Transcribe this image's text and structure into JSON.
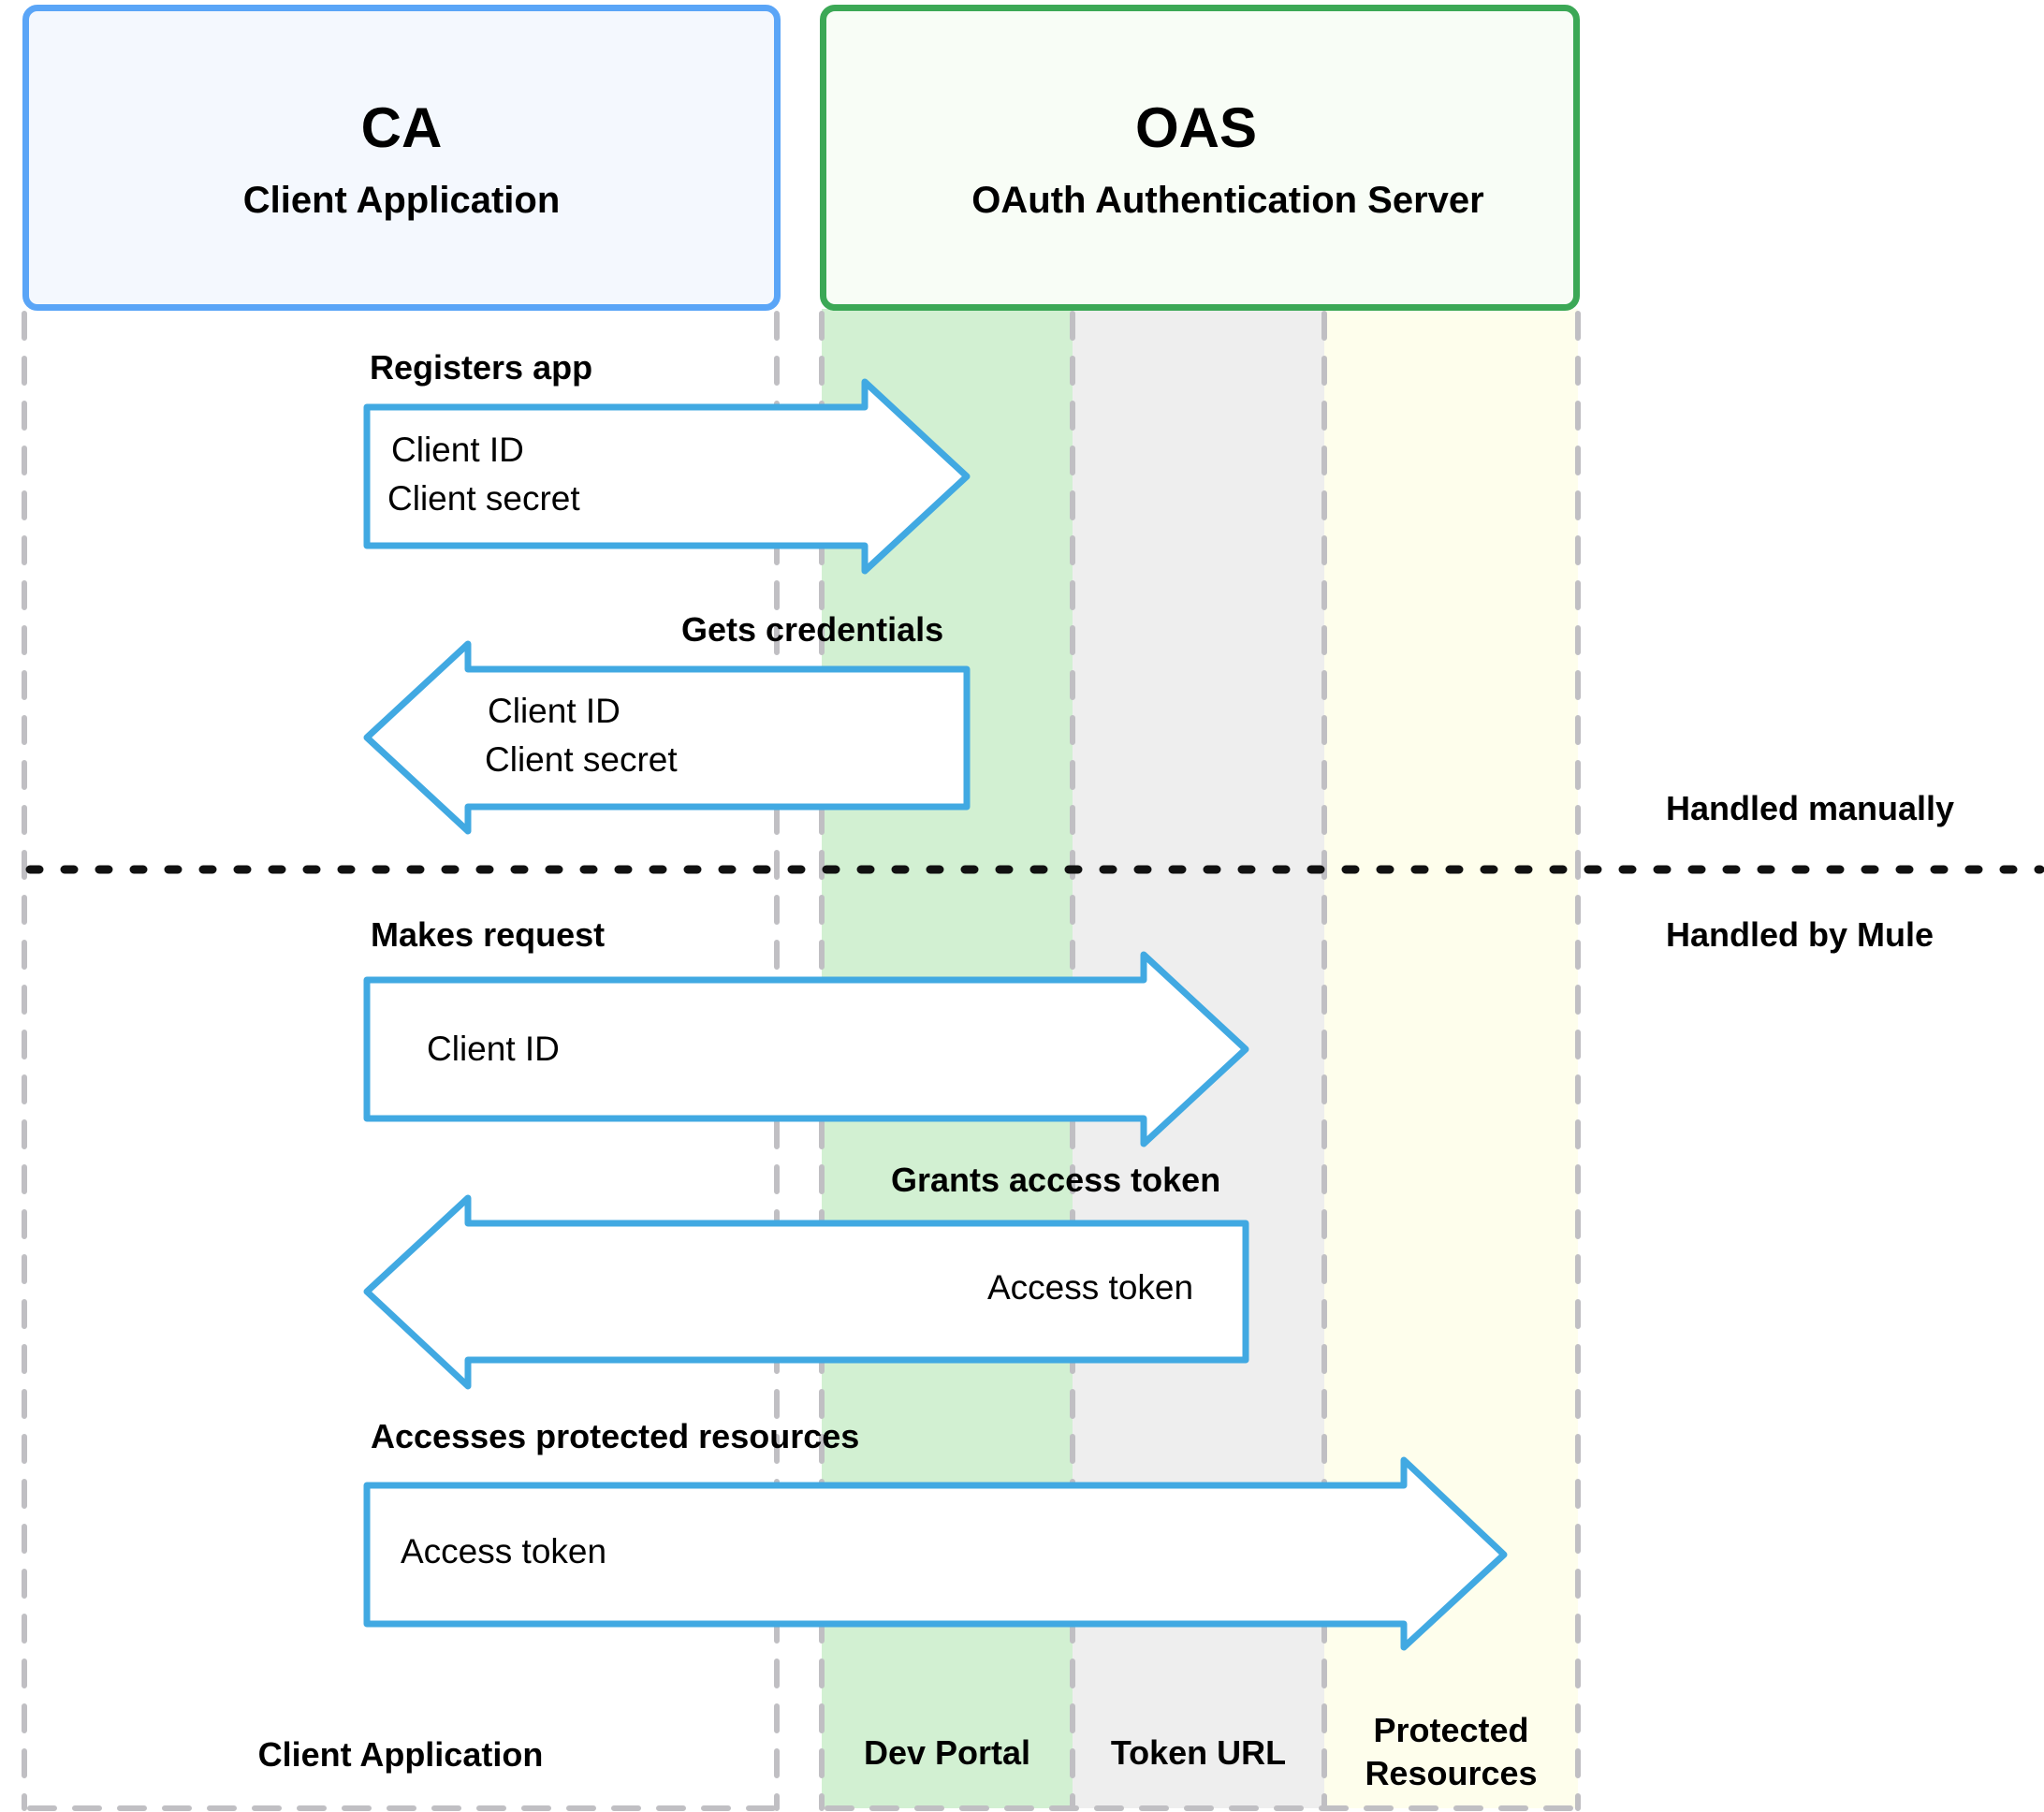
{
  "colors": {
    "ca_border": "#5aa5f7",
    "ca_fill": "#f4f8fe",
    "oas_border": "#3ca856",
    "oas_fill": "#f8fdf6",
    "dev_portal_lane": "#d2f0d2",
    "token_url_lane": "#eeeeee",
    "protected_lane": "#fefeec",
    "arrow_stroke": "#41a9e2",
    "lane_dash": "#c0bfc3",
    "divider": "#111111"
  },
  "actors": {
    "ca": {
      "abbr": "CA",
      "name": "Client Application"
    },
    "oas": {
      "abbr": "OAS",
      "name": "OAuth Authentication Server"
    }
  },
  "lanes": [
    {
      "id": "client",
      "label": "Client Application"
    },
    {
      "id": "dev_portal",
      "label": "Dev Portal"
    },
    {
      "id": "token_url",
      "label": "Token URL"
    },
    {
      "id": "protected",
      "label_line1": "Protected",
      "label_line2": "Resources"
    }
  ],
  "sections": {
    "manual": "Handled manually",
    "mule": "Handled by Mule"
  },
  "steps": [
    {
      "label": "Registers app",
      "direction": "right",
      "target": "dev_portal",
      "payload": [
        "Client ID",
        "Client secret"
      ]
    },
    {
      "label": "Gets credentials",
      "direction": "left",
      "source": "dev_portal",
      "payload": [
        "Client ID",
        "Client secret"
      ]
    },
    {
      "label": "Makes request",
      "direction": "right",
      "target": "token_url",
      "payload": [
        "Client ID"
      ]
    },
    {
      "label": "Grants access token",
      "direction": "left",
      "source": "token_url",
      "payload": [
        "Access token"
      ]
    },
    {
      "label": "Accesses protected resources",
      "direction": "right",
      "target": "protected",
      "payload": [
        "Access token"
      ]
    }
  ]
}
